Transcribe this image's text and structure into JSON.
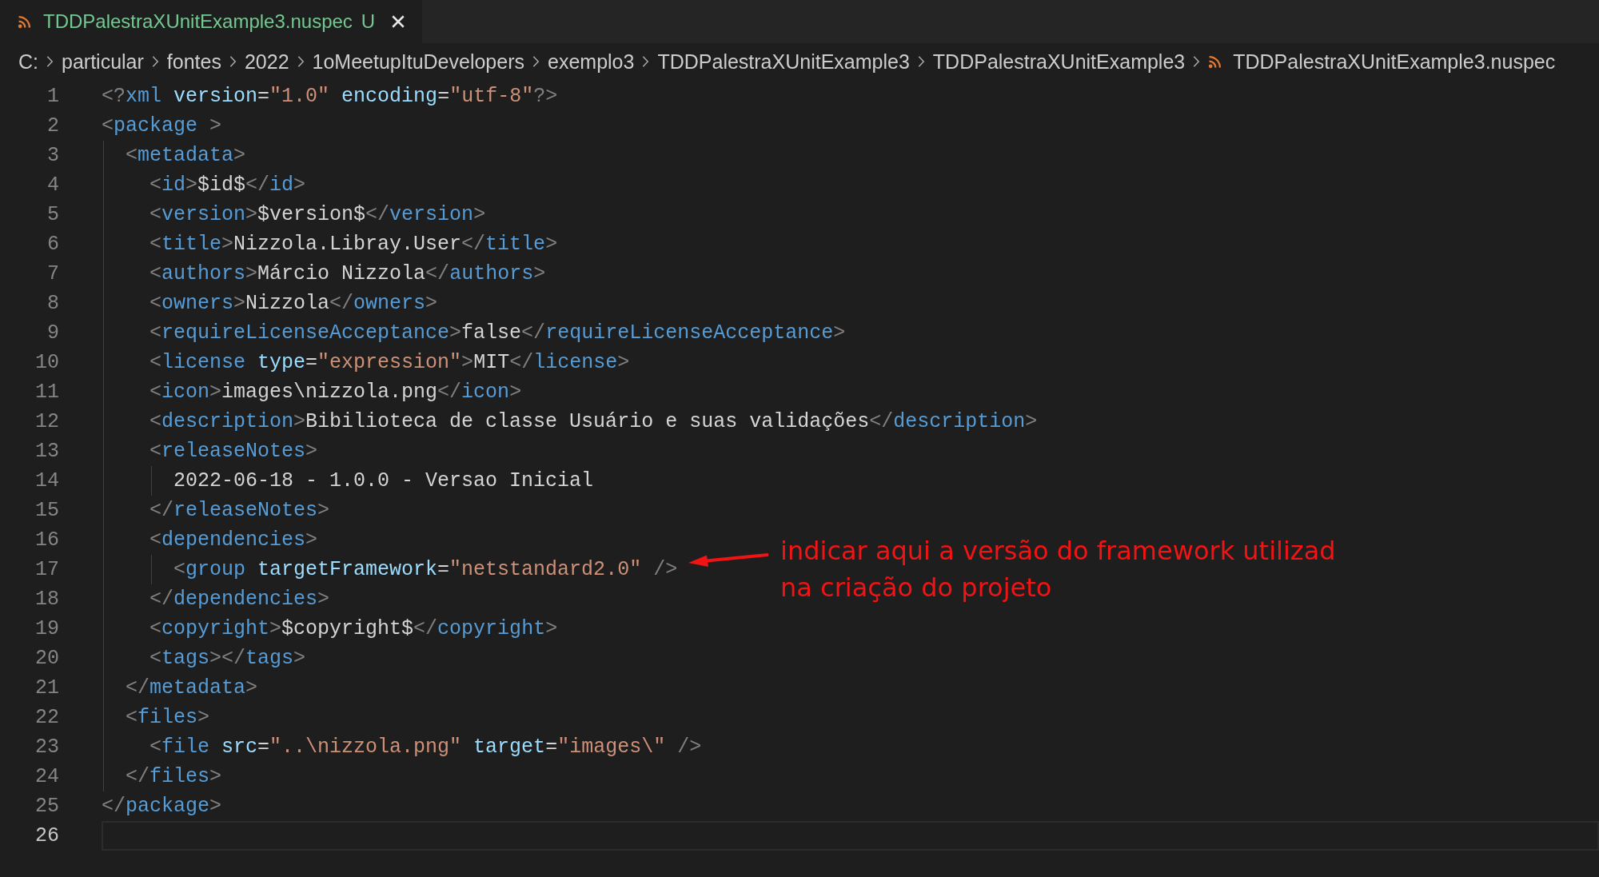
{
  "tabs": [
    {
      "label": "TDDPalestraXUnitExample3.nuspec",
      "status": "U",
      "selected": true
    }
  ],
  "breadcrumb": [
    {
      "kind": "folder",
      "label": "C:"
    },
    {
      "kind": "folder",
      "label": "particular"
    },
    {
      "kind": "folder",
      "label": "fontes"
    },
    {
      "kind": "folder",
      "label": "2022"
    },
    {
      "kind": "folder",
      "label": "1oMeetupItuDevelopers"
    },
    {
      "kind": "folder",
      "label": "exemplo3"
    },
    {
      "kind": "folder",
      "label": "TDDPalestraXUnitExample3"
    },
    {
      "kind": "folder",
      "label": "TDDPalestraXUnitExample3"
    },
    {
      "kind": "file",
      "label": "TDDPalestraXUnitExample3.nuspec"
    }
  ],
  "editor": {
    "lines": [
      {
        "number": "1",
        "current": false,
        "tokens": [
          {
            "kind": "punct",
            "text": "<?"
          },
          {
            "kind": "tag",
            "text": "xml"
          },
          {
            "kind": "attr",
            "text": " version"
          },
          {
            "kind": "eq",
            "text": "="
          },
          {
            "kind": "string",
            "text": "\"1.0\""
          },
          {
            "kind": "attr",
            "text": " encoding"
          },
          {
            "kind": "eq",
            "text": "="
          },
          {
            "kind": "string",
            "text": "\"utf-8\""
          },
          {
            "kind": "punct",
            "text": "?>"
          }
        ]
      },
      {
        "number": "2",
        "current": false,
        "guide": true,
        "tokens": [
          {
            "kind": "punct",
            "text": "<"
          },
          {
            "kind": "tag",
            "text": "package"
          },
          {
            "kind": "punct",
            "text": " >"
          }
        ],
        "children": [
          {
            "number": "3",
            "current": false,
            "tokens": [
              {
                "kind": "punct",
                "text": "<"
              },
              {
                "kind": "tag",
                "text": "metadata"
              },
              {
                "kind": "punct",
                "text": ">"
              }
            ],
            "children": [
              {
                "number": "4",
                "current": false,
                "tokens": [
                  {
                    "kind": "punct",
                    "text": "<"
                  },
                  {
                    "kind": "tag",
                    "text": "id"
                  },
                  {
                    "kind": "punct",
                    "text": ">"
                  },
                  {
                    "kind": "text",
                    "text": "$id$"
                  },
                  {
                    "kind": "punct",
                    "text": "</"
                  },
                  {
                    "kind": "tag",
                    "text": "id"
                  },
                  {
                    "kind": "punct",
                    "text": ">"
                  }
                ]
              },
              {
                "number": "5",
                "current": false,
                "tokens": [
                  {
                    "kind": "punct",
                    "text": "<"
                  },
                  {
                    "kind": "tag",
                    "text": "version"
                  },
                  {
                    "kind": "punct",
                    "text": ">"
                  },
                  {
                    "kind": "text",
                    "text": "$version$"
                  },
                  {
                    "kind": "punct",
                    "text": "</"
                  },
                  {
                    "kind": "tag",
                    "text": "version"
                  },
                  {
                    "kind": "punct",
                    "text": ">"
                  }
                ]
              },
              {
                "number": "6",
                "current": false,
                "tokens": [
                  {
                    "kind": "punct",
                    "text": "<"
                  },
                  {
                    "kind": "tag",
                    "text": "title"
                  },
                  {
                    "kind": "punct",
                    "text": ">"
                  },
                  {
                    "kind": "text",
                    "text": "Nizzola.Libray.User"
                  },
                  {
                    "kind": "punct",
                    "text": "</"
                  },
                  {
                    "kind": "tag",
                    "text": "title"
                  },
                  {
                    "kind": "punct",
                    "text": ">"
                  }
                ]
              },
              {
                "number": "7",
                "current": false,
                "tokens": [
                  {
                    "kind": "punct",
                    "text": "<"
                  },
                  {
                    "kind": "tag",
                    "text": "authors"
                  },
                  {
                    "kind": "punct",
                    "text": ">"
                  },
                  {
                    "kind": "text",
                    "text": "Márcio Nizzola"
                  },
                  {
                    "kind": "punct",
                    "text": "</"
                  },
                  {
                    "kind": "tag",
                    "text": "authors"
                  },
                  {
                    "kind": "punct",
                    "text": ">"
                  }
                ]
              },
              {
                "number": "8",
                "current": false,
                "tokens": [
                  {
                    "kind": "punct",
                    "text": "<"
                  },
                  {
                    "kind": "tag",
                    "text": "owners"
                  },
                  {
                    "kind": "punct",
                    "text": ">"
                  },
                  {
                    "kind": "text",
                    "text": "Nizzola"
                  },
                  {
                    "kind": "punct",
                    "text": "</"
                  },
                  {
                    "kind": "tag",
                    "text": "owners"
                  },
                  {
                    "kind": "punct",
                    "text": ">"
                  }
                ]
              },
              {
                "number": "9",
                "current": false,
                "tokens": [
                  {
                    "kind": "punct",
                    "text": "<"
                  },
                  {
                    "kind": "tag",
                    "text": "requireLicenseAcceptance"
                  },
                  {
                    "kind": "punct",
                    "text": ">"
                  },
                  {
                    "kind": "text",
                    "text": "false"
                  },
                  {
                    "kind": "punct",
                    "text": "</"
                  },
                  {
                    "kind": "tag",
                    "text": "requireLicenseAcceptance"
                  },
                  {
                    "kind": "punct",
                    "text": ">"
                  }
                ]
              },
              {
                "number": "10",
                "current": false,
                "tokens": [
                  {
                    "kind": "punct",
                    "text": "<"
                  },
                  {
                    "kind": "tag",
                    "text": "license"
                  },
                  {
                    "kind": "attr",
                    "text": " type"
                  },
                  {
                    "kind": "eq",
                    "text": "="
                  },
                  {
                    "kind": "string",
                    "text": "\"expression\""
                  },
                  {
                    "kind": "punct",
                    "text": ">"
                  },
                  {
                    "kind": "text",
                    "text": "MIT"
                  },
                  {
                    "kind": "punct",
                    "text": "</"
                  },
                  {
                    "kind": "tag",
                    "text": "license"
                  },
                  {
                    "kind": "punct",
                    "text": ">"
                  }
                ]
              },
              {
                "number": "11",
                "current": false,
                "tokens": [
                  {
                    "kind": "punct",
                    "text": "<"
                  },
                  {
                    "kind": "tag",
                    "text": "icon"
                  },
                  {
                    "kind": "punct",
                    "text": ">"
                  },
                  {
                    "kind": "text",
                    "text": "images\\nizzola.png"
                  },
                  {
                    "kind": "punct",
                    "text": "</"
                  },
                  {
                    "kind": "tag",
                    "text": "icon"
                  },
                  {
                    "kind": "punct",
                    "text": ">"
                  }
                ]
              },
              {
                "number": "12",
                "current": false,
                "tokens": [
                  {
                    "kind": "punct",
                    "text": "<"
                  },
                  {
                    "kind": "tag",
                    "text": "description"
                  },
                  {
                    "kind": "punct",
                    "text": ">"
                  },
                  {
                    "kind": "text",
                    "text": "Bibilioteca de classe Usuário e suas validações"
                  },
                  {
                    "kind": "punct",
                    "text": "</"
                  },
                  {
                    "kind": "tag",
                    "text": "description"
                  },
                  {
                    "kind": "punct",
                    "text": ">"
                  }
                ]
              },
              {
                "number": "13",
                "current": false,
                "guide": true,
                "tokens": [
                  {
                    "kind": "punct",
                    "text": "<"
                  },
                  {
                    "kind": "tag",
                    "text": "releaseNotes"
                  },
                  {
                    "kind": "punct",
                    "text": ">"
                  }
                ],
                "children": [
                  {
                    "number": "14",
                    "current": false,
                    "tokens": [
                      {
                        "kind": "text",
                        "text": "2022-06-18 - 1.0.0 - Versao Inicial"
                      }
                    ]
                  }
                ]
              },
              {
                "number": "15",
                "current": false,
                "tokens": [
                  {
                    "kind": "punct",
                    "text": "</"
                  },
                  {
                    "kind": "tag",
                    "text": "releaseNotes"
                  },
                  {
                    "kind": "punct",
                    "text": ">"
                  }
                ]
              },
              {
                "number": "16",
                "current": false,
                "guide": true,
                "tokens": [
                  {
                    "kind": "punct",
                    "text": "<"
                  },
                  {
                    "kind": "tag",
                    "text": "dependencies"
                  },
                  {
                    "kind": "punct",
                    "text": ">"
                  }
                ],
                "children": [
                  {
                    "number": "17",
                    "current": false,
                    "tokens": [
                      {
                        "kind": "punct",
                        "text": "<"
                      },
                      {
                        "kind": "tag",
                        "text": "group"
                      },
                      {
                        "kind": "attr",
                        "text": " targetFramework"
                      },
                      {
                        "kind": "eq",
                        "text": "="
                      },
                      {
                        "kind": "string",
                        "text": "\"netstandard2.0\""
                      },
                      {
                        "kind": "punct",
                        "text": " />"
                      }
                    ]
                  }
                ]
              },
              {
                "number": "18",
                "current": false,
                "tokens": [
                  {
                    "kind": "punct",
                    "text": "</"
                  },
                  {
                    "kind": "tag",
                    "text": "dependencies"
                  },
                  {
                    "kind": "punct",
                    "text": ">"
                  }
                ]
              },
              {
                "number": "19",
                "current": false,
                "tokens": [
                  {
                    "kind": "punct",
                    "text": "<"
                  },
                  {
                    "kind": "tag",
                    "text": "copyright"
                  },
                  {
                    "kind": "punct",
                    "text": ">"
                  },
                  {
                    "kind": "text",
                    "text": "$copyright$"
                  },
                  {
                    "kind": "punct",
                    "text": "</"
                  },
                  {
                    "kind": "tag",
                    "text": "copyright"
                  },
                  {
                    "kind": "punct",
                    "text": ">"
                  }
                ]
              },
              {
                "number": "20",
                "current": false,
                "tokens": [
                  {
                    "kind": "punct",
                    "text": "<"
                  },
                  {
                    "kind": "tag",
                    "text": "tags"
                  },
                  {
                    "kind": "punct",
                    "text": "></"
                  },
                  {
                    "kind": "tag",
                    "text": "tags"
                  },
                  {
                    "kind": "punct",
                    "text": ">"
                  }
                ]
              }
            ]
          },
          {
            "number": "21",
            "current": false,
            "tokens": [
              {
                "kind": "punct",
                "text": "</"
              },
              {
                "kind": "tag",
                "text": "metadata"
              },
              {
                "kind": "punct",
                "text": ">"
              }
            ]
          },
          {
            "number": "22",
            "current": false,
            "tokens": [
              {
                "kind": "punct",
                "text": "<"
              },
              {
                "kind": "tag",
                "text": "files"
              },
              {
                "kind": "punct",
                "text": ">"
              }
            ],
            "children": [
              {
                "number": "23",
                "current": false,
                "tokens": [
                  {
                    "kind": "punct",
                    "text": "<"
                  },
                  {
                    "kind": "tag",
                    "text": "file"
                  },
                  {
                    "kind": "attr",
                    "text": " src"
                  },
                  {
                    "kind": "eq",
                    "text": "="
                  },
                  {
                    "kind": "string",
                    "text": "\"..\\nizzola.png\""
                  },
                  {
                    "kind": "attr",
                    "text": " target"
                  },
                  {
                    "kind": "eq",
                    "text": "="
                  },
                  {
                    "kind": "string",
                    "text": "\"images\\\""
                  },
                  {
                    "kind": "punct",
                    "text": " />"
                  }
                ]
              }
            ]
          },
          {
            "number": "24",
            "current": false,
            "tokens": [
              {
                "kind": "punct",
                "text": "</"
              },
              {
                "kind": "tag",
                "text": "files"
              },
              {
                "kind": "punct",
                "text": ">"
              }
            ]
          }
        ]
      },
      {
        "number": "25",
        "current": false,
        "tokens": [
          {
            "kind": "punct",
            "text": "</"
          },
          {
            "kind": "tag",
            "text": "package"
          },
          {
            "kind": "punct",
            "text": ">"
          }
        ]
      },
      {
        "number": "26",
        "current": true
      }
    ]
  },
  "annotation": {
    "text": "indicar aqui a versão do framework utilizad\nna criação do projeto"
  }
}
